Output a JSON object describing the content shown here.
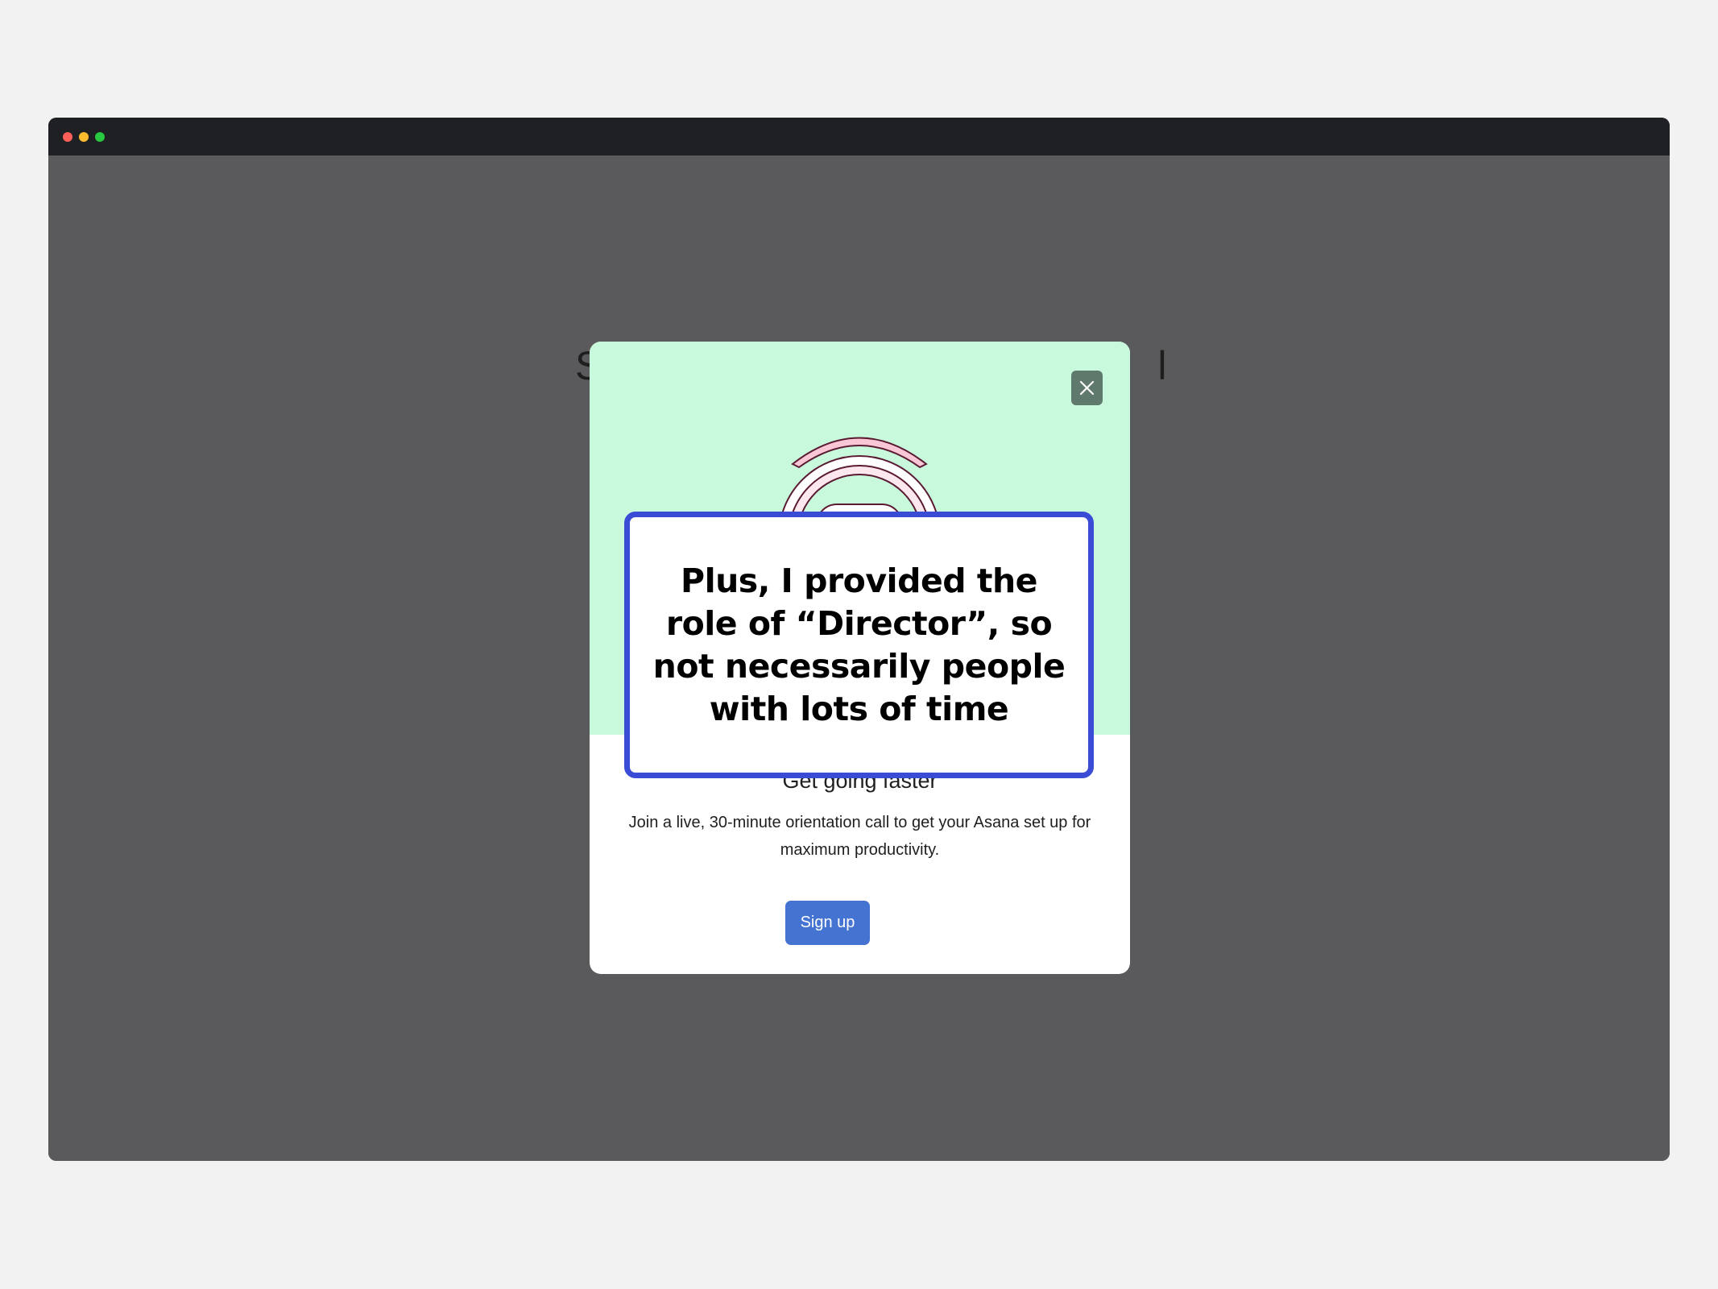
{
  "window": {
    "traffic_lights": [
      "close",
      "minimize",
      "maximize"
    ]
  },
  "background_page": {
    "heading_start": "S",
    "heading_end": "l"
  },
  "modal": {
    "close_icon": "close-icon",
    "title": "Get going faster",
    "body": "Join a live, 30-minute orientation call to get your Asana set up for maximum productivity.",
    "signup_label": "Sign up",
    "colors": {
      "hero_bg": "#c9f9dd",
      "button_bg": "#4573d2",
      "close_bg": "#5f7a6d"
    }
  },
  "annotation": {
    "text": "Plus, I provided the role of “Director”, so not necessarily people with lots of time",
    "border_color": "#3a4bd6"
  }
}
